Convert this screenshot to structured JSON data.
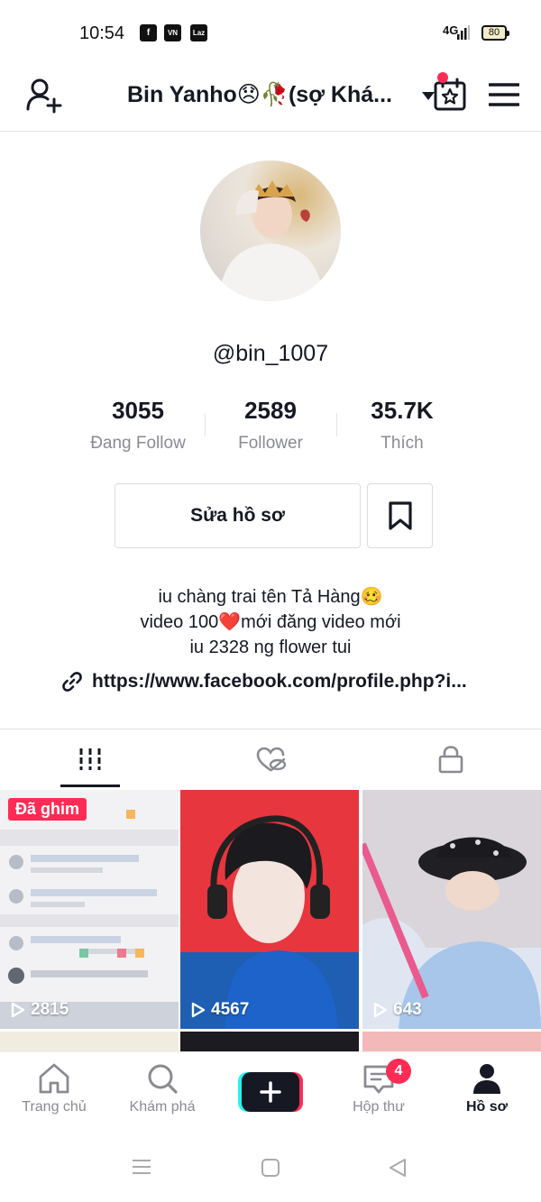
{
  "status_bar": {
    "time": "10:54",
    "app_icons": [
      "f",
      "VN",
      "Laz"
    ],
    "network": "4G",
    "battery": "80"
  },
  "header": {
    "title": "Bin Yanho😞🥀(sợ Khá...",
    "icons": [
      "add-user-icon",
      "calendar-star-icon",
      "menu-icon"
    ]
  },
  "profile": {
    "username": "@bin_1007",
    "stats": [
      {
        "value": "3055",
        "label": "Đang Follow"
      },
      {
        "value": "2589",
        "label": "Follower"
      },
      {
        "value": "35.7K",
        "label": "Thích"
      }
    ],
    "edit_button": "Sửa hồ sơ",
    "bio_lines": [
      "iu chàng trai tên Tả Hàng🥴",
      "video 100❤️mới đăng video mới",
      "iu 2328 ng flower tui"
    ],
    "link": "https://www.facebook.com/profile.php?i..."
  },
  "tabs": {
    "icons": [
      "videos-grid-icon",
      "liked-hidden-icon",
      "private-lock-icon"
    ],
    "active": 0
  },
  "videos": [
    {
      "views": "2815",
      "pinned_label": "Đã ghim"
    },
    {
      "views": "4567"
    },
    {
      "views": "643"
    }
  ],
  "bottom_nav": {
    "items": [
      {
        "label": "Trang chủ"
      },
      {
        "label": "Khám phá"
      },
      {
        "label": "Hộp thư",
        "badge": "4"
      },
      {
        "label": "Hồ sơ"
      }
    ]
  },
  "colors": {
    "accent": "#fe2c55",
    "text": "#161823",
    "muted": "#8a8b91",
    "cyan": "#25f4ee"
  }
}
